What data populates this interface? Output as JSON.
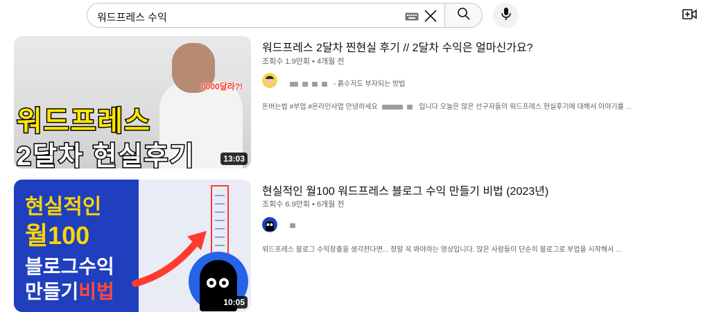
{
  "search": {
    "query": "워드프레스 수익"
  },
  "results": [
    {
      "title": "워드프레스 2달차 찐현실 후기 // 2달차 수익은 얼마신가요?",
      "views": "조회수 1.9만회",
      "age": "4개월 전",
      "channel_suffix": "- 흙수저도 부자되는 방법",
      "description_pre": "돈버는법 #부업 #온라인사업 안녕하세요",
      "description_post": "입니다 오늘은 많은 선구자들의 워드프레스 현실후기에 대해서 이야기를 ...",
      "duration": "13:03",
      "thumb": {
        "line1": "워드프레스",
        "line2": "2달차 현실후기",
        "red_text": "0000달라?!"
      }
    },
    {
      "title": "현실적인 월100 워드프레스 블로그 수익 만들기 비법 (2023년)",
      "views": "조회수 6.9만회",
      "age": "6개월 전",
      "description": "워드프레스 블로그 수익창출을 생각한다면... 정말 꼭 봐야하는 영상입니다. 많은 사람들이 단순히 블로그로 부업을 시작해서 ...",
      "duration": "10:05",
      "thumb": {
        "line1": "현실적인",
        "line2": "월100",
        "line3": "블로그수익",
        "line4a": "만들기",
        "line4b": "비법"
      }
    }
  ],
  "meta_separator": "•",
  "colors": {
    "accent_red": "#ff3b2f",
    "thumb_blue": "#1f3fbf",
    "thumb_yellow": "#ffd500"
  }
}
